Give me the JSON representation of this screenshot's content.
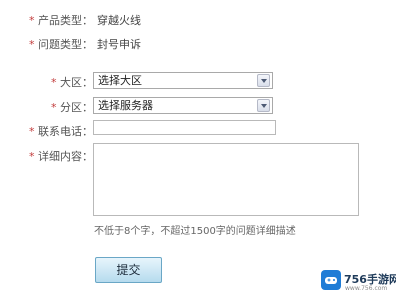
{
  "form": {
    "product_type": {
      "label": "产品类型：",
      "value": "穿越火线"
    },
    "issue_type": {
      "label": "问题类型：",
      "value": "封号申诉"
    },
    "region": {
      "label": "大区：",
      "selected": "选择大区"
    },
    "server": {
      "label": "分区：",
      "selected": "选择服务器"
    },
    "phone": {
      "label": "联系电话：",
      "value": ""
    },
    "detail": {
      "label": "详细内容：",
      "value": "",
      "hint": "不低于8个字，不超过1500字的问题详细描述"
    },
    "required_marker": "*",
    "submit_label": "提交"
  },
  "watermark": {
    "name": "756手游网",
    "url": "www.756.com"
  },
  "colors": {
    "required": "#c23b3b",
    "submit_bg": "#b6dbee",
    "logo": "#1f7cd6"
  }
}
